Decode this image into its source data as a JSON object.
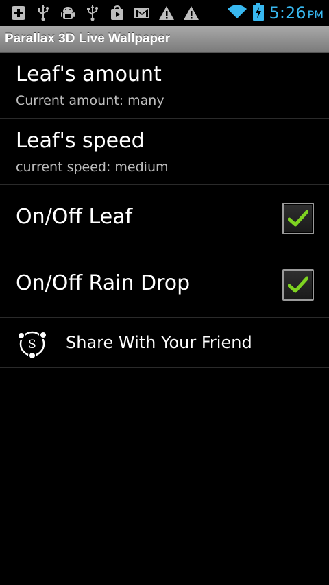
{
  "status_bar": {
    "left_icons": [
      "add-icon",
      "usb-icon",
      "android-debug-icon",
      "usb-icon",
      "play-store-icon",
      "gmail-icon",
      "warning-icon",
      "warning-icon"
    ],
    "right_icons": [
      "wifi-icon",
      "battery-charging-icon"
    ],
    "time": "5:26",
    "ampm": "PM",
    "accent_color": "#38b8f0"
  },
  "title_bar": {
    "title": "Parallax 3D Live Wallpaper"
  },
  "settings": {
    "leaf_amount": {
      "title": "Leaf's amount",
      "summary": "Current amount: many"
    },
    "leaf_speed": {
      "title": "Leaf's speed",
      "summary": "current speed: medium"
    },
    "onoff_leaf": {
      "title": "On/Off Leaf",
      "checked": true
    },
    "onoff_rain": {
      "title": "On/Off Rain Drop",
      "checked": true
    },
    "share": {
      "label": "Share With Your Friend",
      "icon": "share-s-icon"
    }
  },
  "colors": {
    "check_green": "#7ed321"
  }
}
